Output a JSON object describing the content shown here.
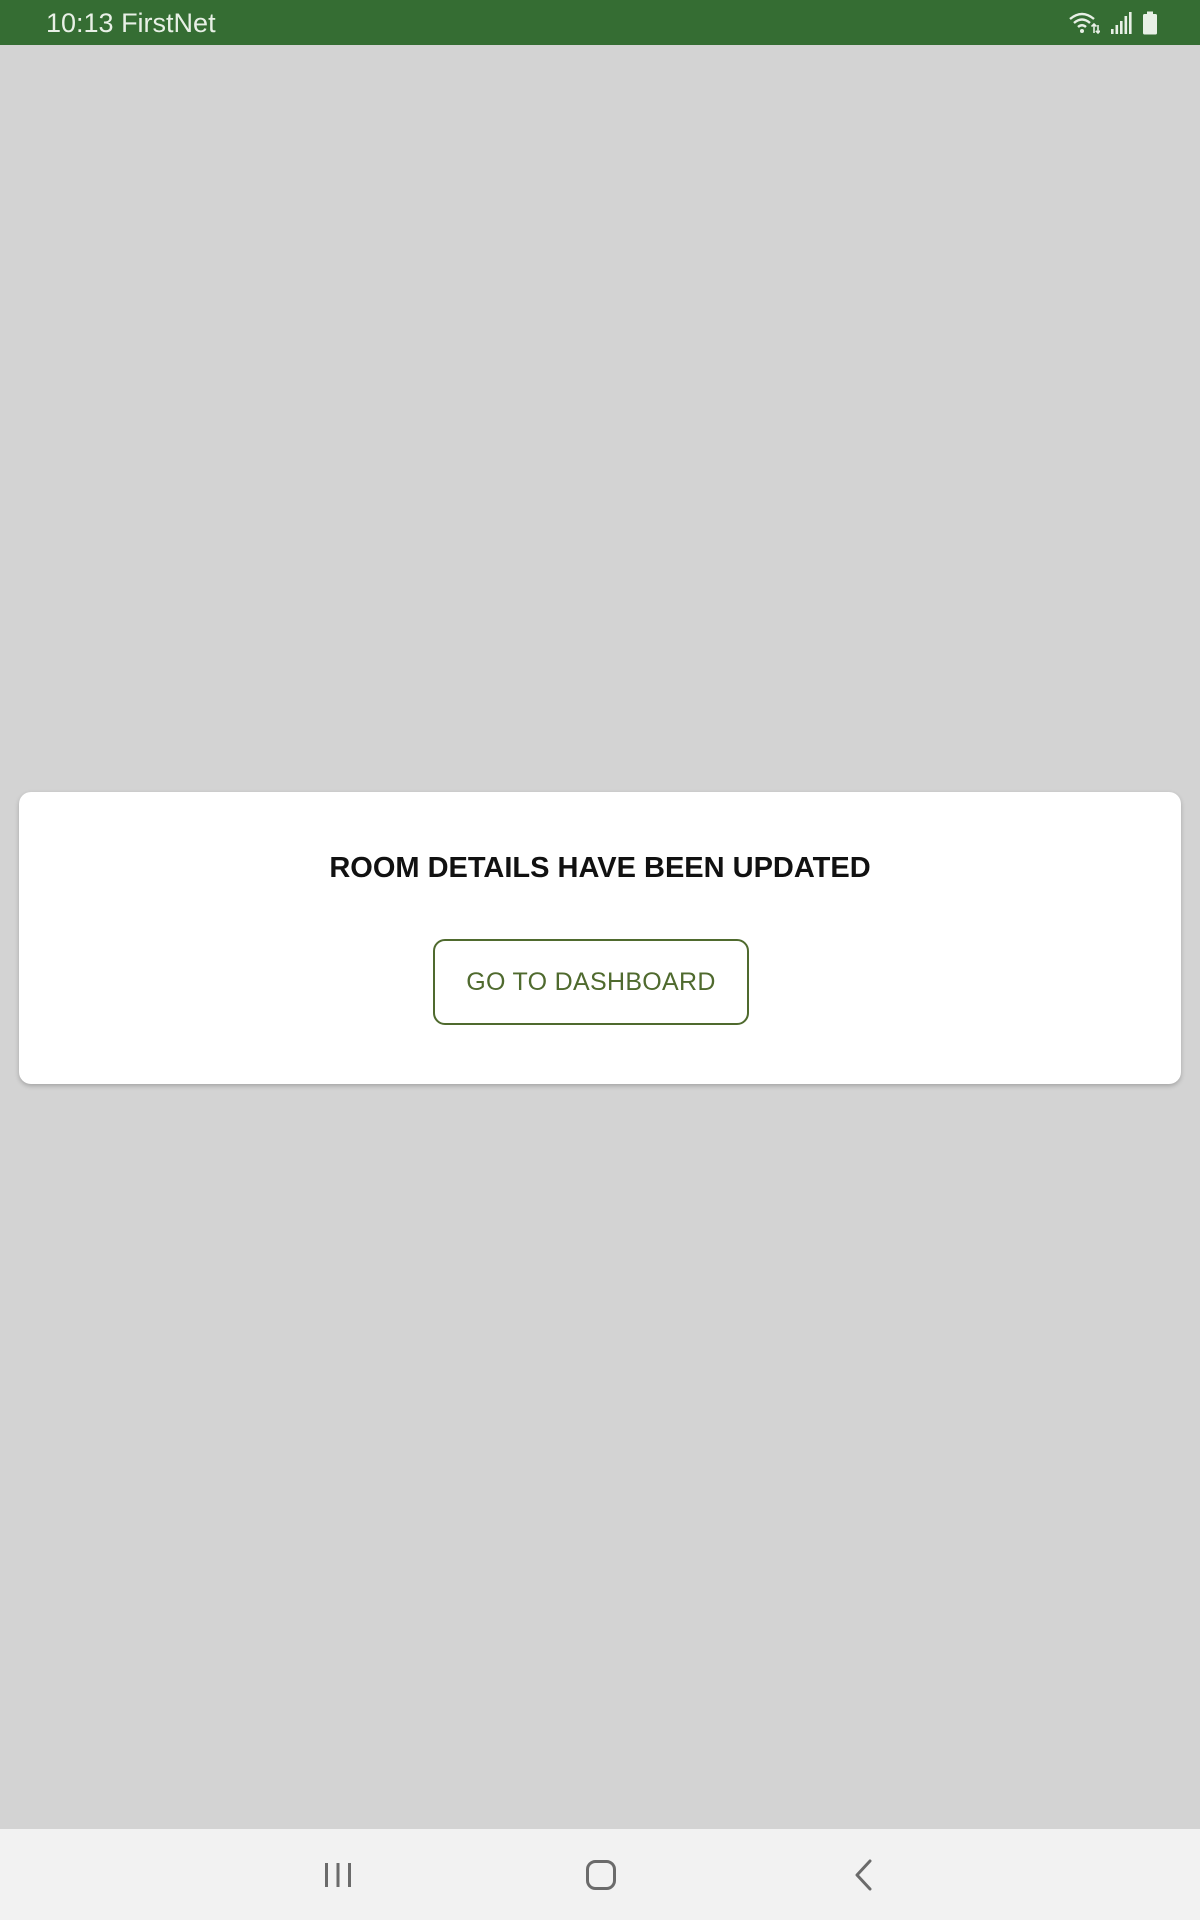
{
  "status_bar": {
    "time_carrier": "10:13 FirstNet",
    "icons": [
      "wifi-icon",
      "signal-icon",
      "battery-icon"
    ],
    "background_color": "#356d33"
  },
  "dialog": {
    "message": "ROOM DETAILS HAVE BEEN UPDATED",
    "button_label": "GO TO DASHBOARD",
    "accent_color": "#4f6a2e"
  },
  "nav_bar": {
    "buttons": [
      "recent-apps-icon",
      "home-icon",
      "back-icon"
    ]
  }
}
